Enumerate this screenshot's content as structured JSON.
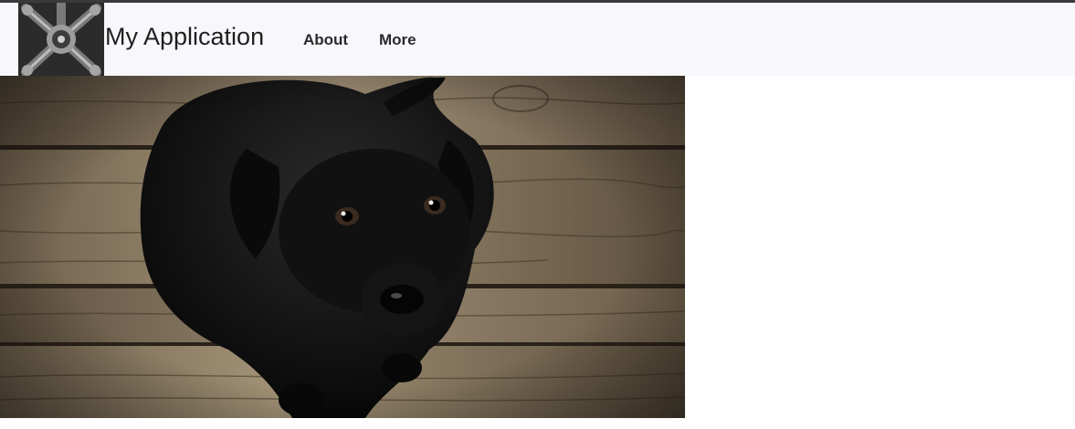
{
  "header": {
    "brand_title": "My Application",
    "logo_icon": "logo-gear-icon"
  },
  "nav": {
    "items": [
      {
        "label": "About"
      },
      {
        "label": "More"
      }
    ]
  },
  "hero": {
    "image_subject": "black puppy on wooden floor"
  },
  "colors": {
    "top_border": "#3a3a3a",
    "navbar_bg": "#f8f8fc",
    "page_bg": "#ffffff",
    "wood": "#8a7a64",
    "dog": "#0e0e0e"
  }
}
